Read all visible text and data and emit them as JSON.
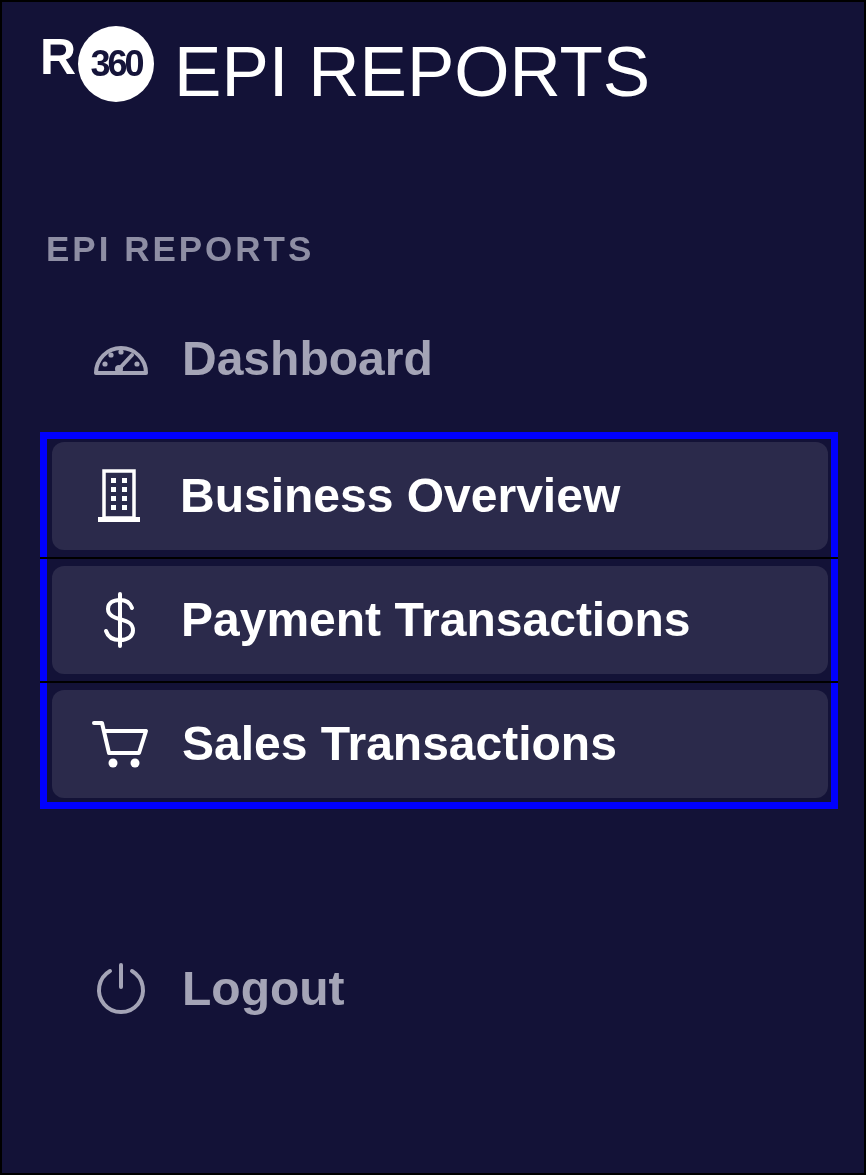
{
  "header": {
    "logo": {
      "letter": "R",
      "badge": "360"
    },
    "title": "EPI REPORTS"
  },
  "nav": {
    "section_label": "EPI REPORTS",
    "items": [
      {
        "kind": "gauge",
        "label": "Dashboard",
        "selected": false,
        "highlighted": false
      },
      {
        "kind": "building",
        "label": "Business Overview",
        "selected": true,
        "highlighted": true
      },
      {
        "kind": "dollar",
        "label": "Payment Transactions",
        "selected": true,
        "highlighted": true
      },
      {
        "kind": "cart",
        "label": "Sales Transactions",
        "selected": true,
        "highlighted": true
      }
    ]
  },
  "footer": {
    "items": [
      {
        "kind": "power",
        "label": "Logout",
        "selected": false
      }
    ]
  }
}
